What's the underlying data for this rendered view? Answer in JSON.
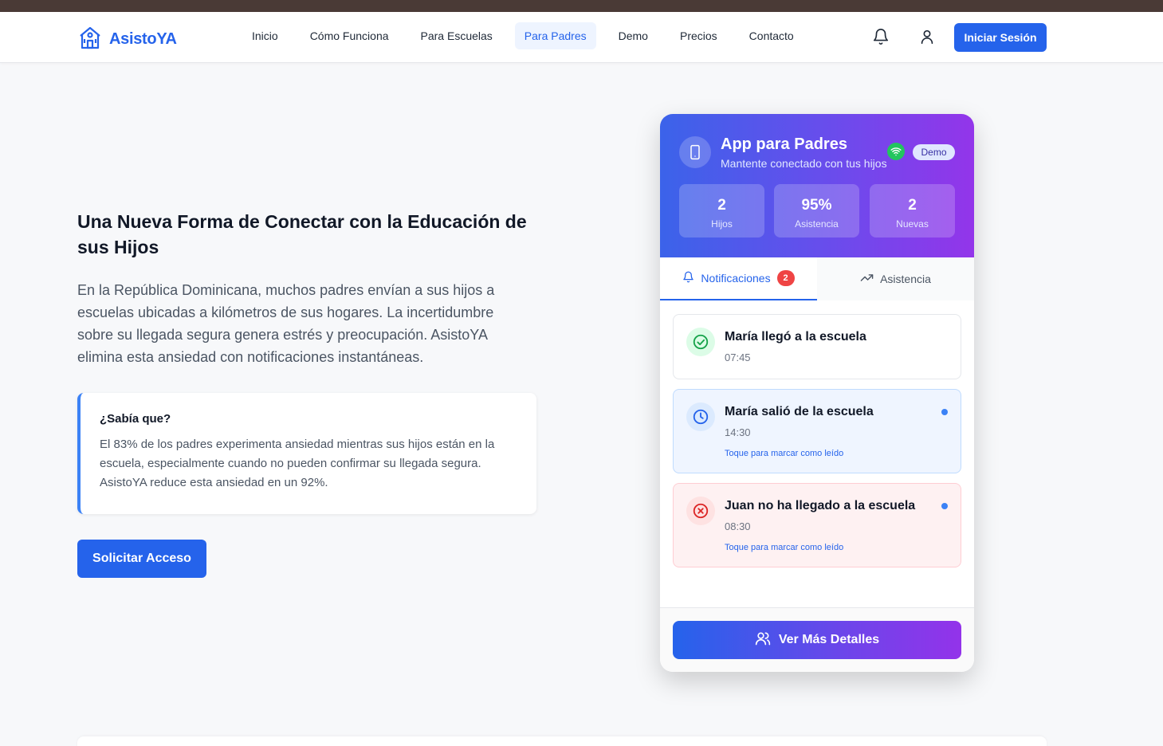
{
  "nav": {
    "brand": "AsistoYA",
    "items": [
      {
        "label": "Inicio"
      },
      {
        "label": "Cómo Funciona"
      },
      {
        "label": "Para Escuelas"
      },
      {
        "label": "Para Padres",
        "active": true
      },
      {
        "label": "Demo"
      },
      {
        "label": "Precios"
      },
      {
        "label": "Contacto"
      }
    ],
    "login_label": "Iniciar Sesión",
    "icons": [
      "bell-icon",
      "user-icon"
    ]
  },
  "hero": {
    "title": "Una Nueva Forma de Conectar con la Educación de sus Hijos",
    "description": "En la República Dominicana, muchos padres envían a sus hijos a escuelas ubicadas a kilómetros de sus hogares. La incertidumbre sobre su llegada segura genera estrés y preocupación. AsistoYA elimina esta ansiedad con notificaciones instantáneas.",
    "fact_title": "¿Sabía que?",
    "fact_text": "El 83% de los padres experimenta ansiedad mientras sus hijos están en la escuela, especialmente cuando no pueden confirmar su llegada segura. AsistoYA reduce esta ansiedad en un 92%.",
    "cta_label": "Solicitar Acceso"
  },
  "app": {
    "title": "App para Padres",
    "subtitle": "Mantente conectado con tus hijos",
    "badge": "Demo",
    "stats": [
      {
        "value": "2",
        "label": "Hijos"
      },
      {
        "value": "95%",
        "label": "Asistencia"
      },
      {
        "value": "2",
        "label": "Nuevas"
      }
    ],
    "tabs": [
      {
        "label": "Notificaciones",
        "count": "2",
        "active": true
      },
      {
        "label": "Asistencia"
      }
    ],
    "notifications": [
      {
        "title": "María llegó a la escuela",
        "time": "07:45",
        "status": "read",
        "icon": "check-circle-icon"
      },
      {
        "title": "María salió de la escuela",
        "time": "14:30",
        "hint": "Toque para marcar como leído",
        "status": "unread",
        "icon": "clock-icon"
      },
      {
        "title": "Juan no ha llegado a la escuela",
        "time": "08:30",
        "hint": "Toque para marcar como leído",
        "status": "unread",
        "icon": "x-circle-icon"
      }
    ],
    "details_label": "Ver Más Detalles"
  },
  "colors": {
    "primary": "#2563eb",
    "gradient_start": "#3b63ea",
    "gradient_end": "#9335ea",
    "success": "#22c55e",
    "danger": "#ef4444"
  }
}
